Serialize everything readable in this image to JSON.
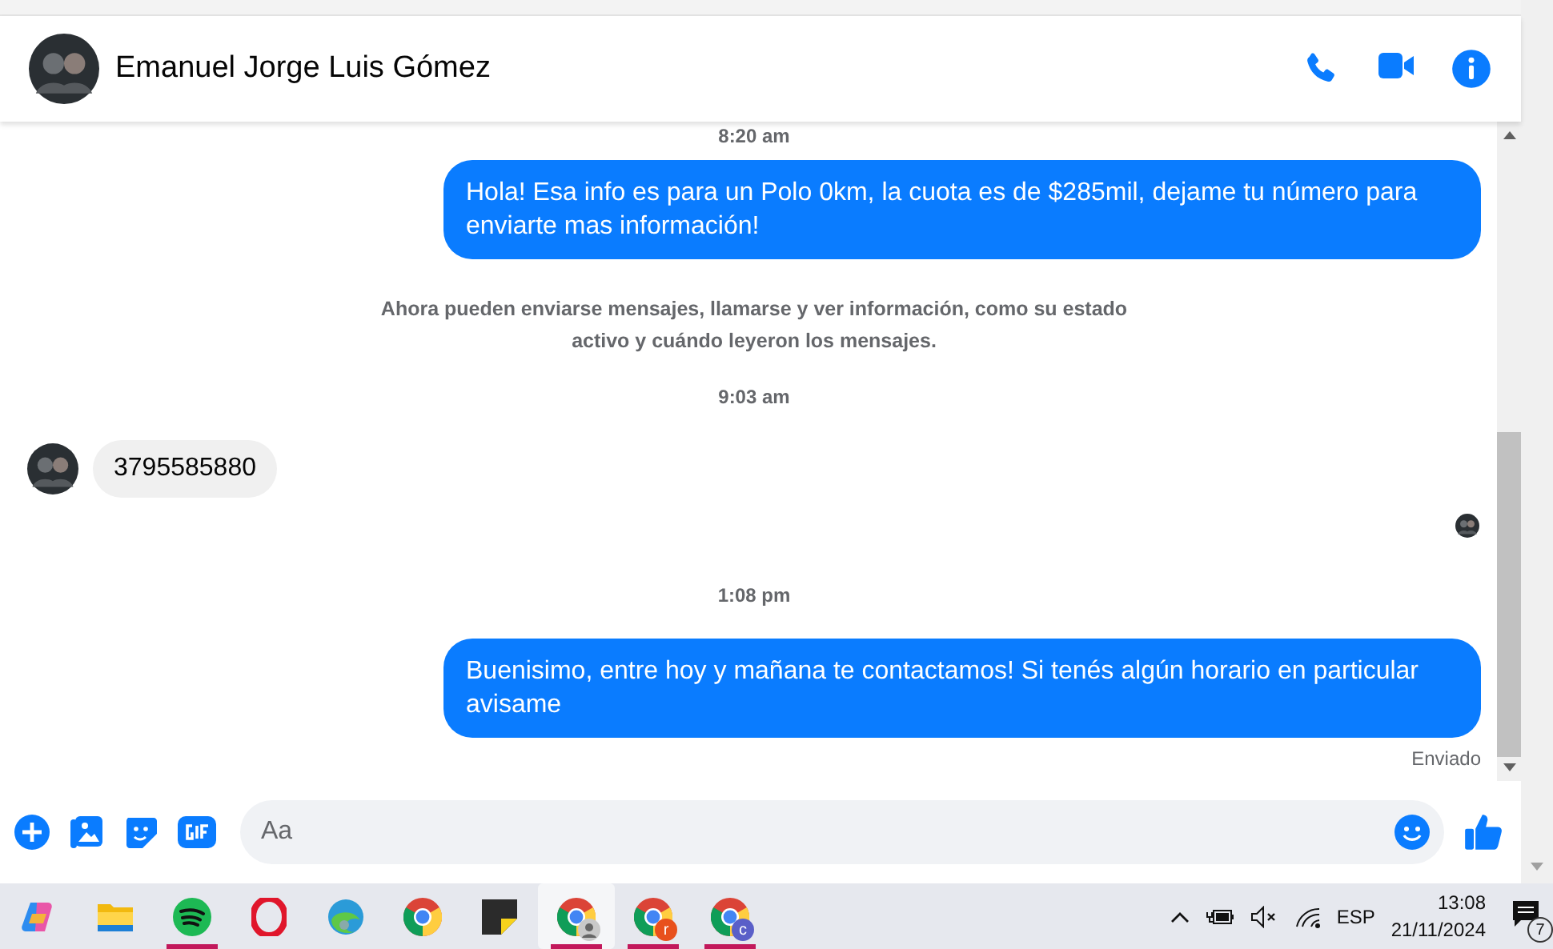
{
  "conversation": {
    "contact_name": "Emanuel Jorge Luis Gómez"
  },
  "messages": [
    {
      "kind": "timestamp",
      "text": "8:20 am"
    },
    {
      "kind": "outgoing",
      "text": "Hola! Esa info es para un Polo 0km, la cuota es de $285mil, dejame tu número para enviarte mas información!"
    },
    {
      "kind": "system",
      "text": "Ahora pueden enviarse mensajes, llamarse y ver información, como su estado activo y cuándo leyeron los mensajes."
    },
    {
      "kind": "timestamp",
      "text": "9:03 am"
    },
    {
      "kind": "incoming",
      "text": "3795585880"
    },
    {
      "kind": "seen"
    },
    {
      "kind": "timestamp",
      "text": "1:08 pm"
    },
    {
      "kind": "outgoing",
      "text": "Buenisimo, entre hoy y mañana te contactamos! Si tenés algún horario en particular avisame"
    },
    {
      "kind": "status",
      "text": "Enviado"
    }
  ],
  "composer": {
    "placeholder": "Aa"
  },
  "taskbar": {
    "apps": [
      {
        "kind": "copilot",
        "running": false,
        "active": false
      },
      {
        "kind": "folder",
        "running": false,
        "active": false
      },
      {
        "kind": "spotify",
        "running": true,
        "active": false
      },
      {
        "kind": "opera",
        "running": false,
        "active": false
      },
      {
        "kind": "edge",
        "running": false,
        "active": false
      },
      {
        "kind": "chrome",
        "running": false,
        "active": false
      },
      {
        "kind": "notes",
        "running": false,
        "active": false
      },
      {
        "kind": "chrome-profile",
        "running": true,
        "active": true
      },
      {
        "kind": "chrome",
        "running": true,
        "active": false,
        "badge": "r",
        "color": "#e8501c"
      },
      {
        "kind": "chrome",
        "running": true,
        "active": false,
        "badge": "c",
        "color": "#5a5fc8"
      }
    ],
    "language": "ESP",
    "time": "13:08",
    "date": "21/11/2024",
    "notifications": "7"
  }
}
